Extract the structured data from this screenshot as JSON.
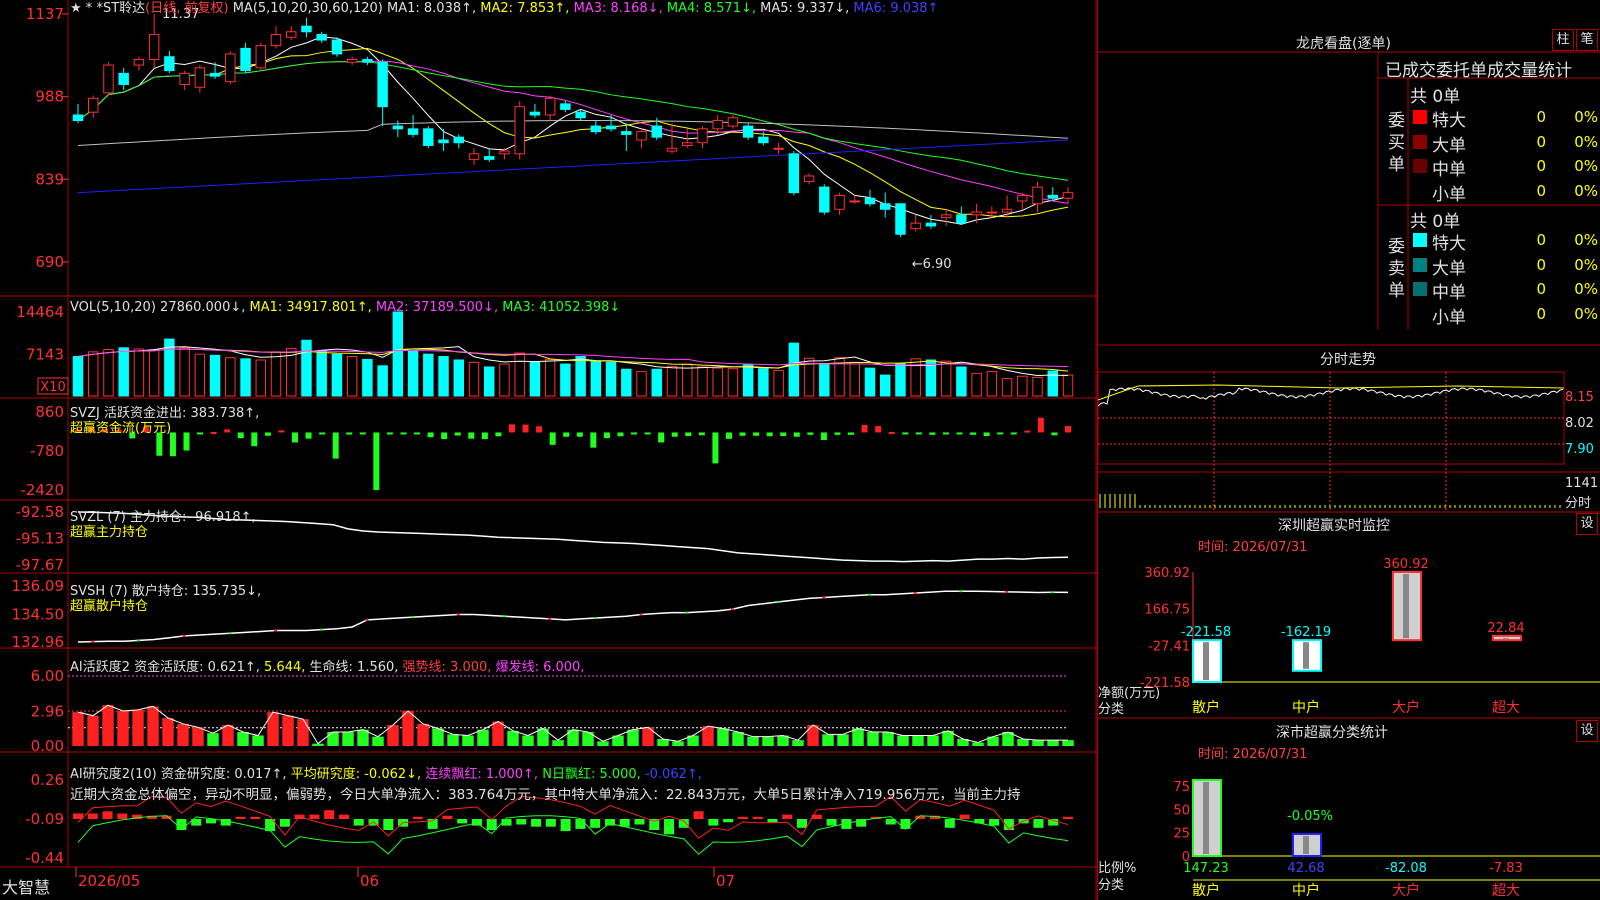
{
  "colors": {
    "up": "#ff3030",
    "down": "#00ffff",
    "vol_up": "#ff3030",
    "vol_down": "#00ffff",
    "ma5": "#ffffff",
    "ma10": "#ffff00",
    "ma20": "#ff40ff",
    "ma30": "#20ff20",
    "ma60": "#c0c0c0",
    "ma120": "#2020ff",
    "frame": "#b00000",
    "pos": "#ff2020",
    "neg": "#20ff20"
  },
  "main": {
    "stars": "★ *",
    "title": "*ST聆达",
    "period": "(日线, 前复权)",
    "ma_label": "MA(5,10,20,30,60,120)",
    "ma1": "MA1: 8.038↑,",
    "ma2": "MA2: 7.853↑,",
    "ma3": "MA3: 8.168↓,",
    "ma4": "MA4: 8.571↓,",
    "ma5": "MA5: 9.337↓,",
    "ma6": "MA6: 9.038↑",
    "y_ticks": [
      "1137",
      "988",
      "839",
      "690"
    ],
    "high_label": "11.37",
    "low_label": "←6.90"
  },
  "vol": {
    "label": "VOL(5,10,20)",
    "value": "27860.000↓,",
    "ma1": "MA1: 34917.801↑,",
    "ma2": "MA2: 37189.500↓,",
    "ma3": "MA3: 41052.398↓",
    "y_ticks": [
      "14464",
      "7143"
    ],
    "unit": "X10"
  },
  "svzj": {
    "label": "SVZJ  活跃资金进出: 383.738↑,",
    "sub": "超赢资金流(万元)",
    "y_ticks": [
      "860",
      "-780",
      "-2420"
    ]
  },
  "svzl": {
    "label": "SVZL (7) 主力持仓: -96.918↑,",
    "sub": "超赢主力持仓",
    "y_ticks": [
      "-92.58",
      "-95.13",
      "-97.67"
    ]
  },
  "svsh": {
    "label": "SVSH (7) 散户持仓: 135.735↓,",
    "sub": "超赢散户持仓",
    "y_ticks": [
      "136.09",
      "134.50",
      "132.96"
    ]
  },
  "ai1": {
    "label": "AI活跃度2 资金活跃度: 0.621↑,",
    "v2": "5.644,",
    "v3": "生命线: 1.560,",
    "v4": "强势线: 3.000,",
    "v5": "爆发线: 6.000,",
    "y_ticks": [
      "6.00",
      "2.96",
      "0.00"
    ]
  },
  "ai2": {
    "label": "AI研究度2(10) 资金研究度: 0.017↑,",
    "v2": "平均研究度: -0.062↓,",
    "v3": "连续飘红: 1.000↑,",
    "v4": "N日飘红: 5.000,",
    "v5": "-0.062↑,",
    "comment": "近期大资金总体偏空，异动不明显，偏弱势，今日大单净流入：383.764万元，其中特大单净流入：22.843万元，大单5日累计净入719.956万元，当前主力持",
    "y_ticks": [
      "0.26",
      "-0.09",
      "-0.44"
    ]
  },
  "xaxis": {
    "labels": [
      "2026/05",
      "06",
      "07"
    ]
  },
  "brand": "大智慧",
  "right": {
    "lhb_title": "龙虎看盘(逐单)",
    "btn1": "柱",
    "btn2": "笔",
    "order_title": "已成交委托单成交量统计",
    "buy": {
      "side": "委买单",
      "total": "共 0单",
      "rows": [
        {
          "name": "特大",
          "color": "#ff0000",
          "n": "0",
          "pct": "0%"
        },
        {
          "name": "大单",
          "color": "#8b0000",
          "n": "0",
          "pct": "0%"
        },
        {
          "name": "中单",
          "color": "#6b0000",
          "n": "0",
          "pct": "0%"
        },
        {
          "name": "小单",
          "color": "#000000",
          "n": "0",
          "pct": "0%"
        }
      ]
    },
    "sell": {
      "side": "委卖单",
      "total": "共 0单",
      "rows": [
        {
          "name": "特大",
          "color": "#00ffff",
          "n": "0",
          "pct": "0%"
        },
        {
          "name": "大单",
          "color": "#008080",
          "n": "0",
          "pct": "0%"
        },
        {
          "name": "中单",
          "color": "#007070",
          "n": "0",
          "pct": "0%"
        },
        {
          "name": "小单",
          "color": "#000000",
          "n": "0",
          "pct": "0%"
        }
      ]
    },
    "intraday_title": "分时走势",
    "intraday_ticks": [
      "8.15",
      "8.02",
      "7.90"
    ],
    "intraday_vol": "1141",
    "intraday_vol_label": "分时",
    "sz_title": "深圳超赢实时监控",
    "sz_time": "时间: 2026/07/31",
    "set": "设",
    "sz_ticks": [
      "360.92",
      "166.75",
      "-27.41",
      "-221.58"
    ],
    "sz_ylabel": "净额(万元)",
    "sz_xlabel": "分类",
    "cat_labels": [
      "散户",
      "中户",
      "大户",
      "超大"
    ],
    "sz_values": [
      "-221.58",
      "-162.19",
      "360.92",
      "22.84"
    ],
    "dist_title": "深市超赢分类统计",
    "dist_time": "时间: 2026/07/31",
    "dist_ticks": [
      "75",
      "50",
      "25",
      "0"
    ],
    "dist_ylabel": "比例%",
    "dist_xlabel": "分类",
    "dist_pct": "-0.05%",
    "dist_values": [
      "147.23",
      "42.68",
      "-82.08",
      "-7.83"
    ]
  },
  "chart_data": [
    {
      "type": "candlestick",
      "title": "*ST聆达 (日线, 前复权)",
      "ylim": [
        6.9,
        11.37
      ],
      "y_ticks": [
        11.37,
        9.88,
        8.39,
        6.9
      ],
      "ohlc": [
        [
          9.55,
          9.75,
          9.4,
          9.45
        ],
        [
          9.6,
          9.9,
          9.5,
          9.85
        ],
        [
          9.95,
          10.5,
          9.9,
          10.45
        ],
        [
          10.3,
          10.4,
          10.0,
          10.1
        ],
        [
          10.45,
          10.6,
          10.35,
          10.55
        ],
        [
          10.55,
          11.37,
          10.4,
          11.0
        ],
        [
          10.6,
          10.7,
          10.3,
          10.35
        ],
        [
          10.1,
          10.35,
          10.0,
          10.3
        ],
        [
          10.05,
          10.45,
          9.95,
          10.4
        ],
        [
          10.3,
          10.5,
          10.2,
          10.25
        ],
        [
          10.15,
          10.7,
          10.1,
          10.65
        ],
        [
          10.75,
          10.85,
          10.3,
          10.35
        ],
        [
          10.4,
          10.85,
          10.35,
          10.8
        ],
        [
          10.8,
          11.15,
          10.75,
          11.0
        ],
        [
          10.95,
          11.15,
          10.9,
          11.05
        ],
        [
          11.15,
          11.3,
          10.95,
          11.05
        ],
        [
          11.0,
          11.05,
          10.85,
          10.9
        ],
        [
          10.9,
          10.95,
          10.6,
          10.65
        ],
        [
          10.5,
          10.6,
          10.45,
          10.55
        ],
        [
          10.55,
          10.6,
          10.45,
          10.5
        ],
        [
          10.5,
          10.55,
          9.35,
          9.7
        ],
        [
          9.35,
          9.45,
          9.15,
          9.3
        ],
        [
          9.3,
          9.55,
          9.15,
          9.2
        ],
        [
          9.3,
          9.35,
          8.95,
          9.0
        ],
        [
          9.1,
          9.3,
          8.9,
          9.05
        ],
        [
          9.15,
          9.2,
          8.95,
          9.05
        ],
        [
          8.75,
          8.95,
          8.65,
          8.85
        ],
        [
          8.8,
          8.95,
          8.7,
          8.75
        ],
        [
          8.85,
          8.95,
          8.75,
          8.9
        ],
        [
          8.85,
          9.8,
          8.75,
          9.7
        ],
        [
          9.6,
          9.75,
          9.5,
          9.55
        ],
        [
          9.55,
          9.9,
          9.45,
          9.85
        ],
        [
          9.75,
          9.8,
          9.6,
          9.65
        ],
        [
          9.6,
          9.65,
          9.45,
          9.5
        ],
        [
          9.35,
          9.45,
          9.2,
          9.25
        ],
        [
          9.35,
          9.55,
          9.25,
          9.3
        ],
        [
          9.25,
          9.4,
          8.9,
          9.2
        ],
        [
          9.1,
          9.3,
          8.95,
          9.25
        ],
        [
          9.35,
          9.5,
          9.1,
          9.15
        ],
        [
          8.9,
          9.4,
          8.85,
          8.95
        ],
        [
          9.0,
          9.3,
          8.95,
          9.05
        ],
        [
          9.05,
          9.35,
          8.95,
          9.3
        ],
        [
          9.3,
          9.55,
          9.2,
          9.45
        ],
        [
          9.35,
          9.55,
          9.3,
          9.5
        ],
        [
          9.35,
          9.4,
          9.1,
          9.15
        ],
        [
          9.15,
          9.25,
          9.0,
          9.05
        ],
        [
          8.95,
          9.05,
          8.85,
          8.95
        ],
        [
          8.85,
          8.9,
          8.1,
          8.15
        ],
        [
          8.35,
          8.5,
          8.3,
          8.45
        ],
        [
          8.25,
          8.3,
          7.75,
          7.8
        ],
        [
          7.85,
          8.15,
          7.75,
          8.1
        ],
        [
          8.0,
          8.1,
          7.95,
          8.0
        ],
        [
          8.05,
          8.2,
          7.9,
          7.95
        ],
        [
          7.95,
          8.15,
          7.7,
          7.85
        ],
        [
          7.95,
          7.95,
          7.35,
          7.4
        ],
        [
          7.5,
          7.75,
          7.45,
          7.6
        ],
        [
          7.6,
          7.75,
          7.5,
          7.55
        ],
        [
          7.7,
          7.85,
          7.55,
          7.75
        ],
        [
          7.75,
          7.9,
          7.6,
          7.6
        ],
        [
          7.75,
          7.95,
          7.6,
          7.8
        ],
        [
          7.8,
          7.9,
          7.7,
          7.8
        ],
        [
          7.8,
          8.1,
          7.7,
          7.85
        ],
        [
          8.0,
          8.15,
          7.85,
          8.1
        ],
        [
          7.95,
          8.35,
          7.8,
          8.25
        ],
        [
          8.1,
          8.25,
          8.0,
          8.05
        ],
        [
          8.05,
          8.25,
          7.95,
          8.15
        ]
      ],
      "ma_last": {
        "MA1": 8.038,
        "MA2": 7.853,
        "MA3": 8.168,
        "MA4": 8.571,
        "MA5": 9.337,
        "MA6": 9.038
      }
    },
    {
      "type": "bar",
      "title": "VOL(5,10,20)",
      "unit": "X10",
      "ylim": [
        0,
        14464
      ],
      "values": [
        6800,
        7600,
        8000,
        8300,
        8100,
        7900,
        9800,
        8300,
        7200,
        7000,
        6600,
        6400,
        6200,
        7600,
        8200,
        9600,
        7800,
        7200,
        6800,
        6300,
        5200,
        14464,
        7800,
        7200,
        6800,
        6200,
        5800,
        5000,
        5500,
        7400,
        5900,
        6300,
        5500,
        6800,
        6000,
        5800,
        4600,
        4200,
        4600,
        5100,
        5500,
        5000,
        4800,
        4700,
        5400,
        4700,
        4400,
        9100,
        6500,
        5600,
        6600,
        5800,
        4800,
        3600,
        5600,
        6400,
        6200,
        6000,
        5000,
        3900,
        4200,
        3000,
        3400,
        3200,
        4300,
        3600
      ],
      "ma1": 34917.801,
      "ma2": 37189.5,
      "ma3": 41052.398,
      "last": 27860.0
    },
    {
      "type": "bar",
      "title": "SVZJ 活跃资金进出",
      "ylabel": "超赢资金流(万元)",
      "ylim": [
        -2420,
        860
      ],
      "values": [
        120,
        200,
        150,
        110,
        -250,
        240,
        -980,
        -1000,
        -760,
        -80,
        20,
        130,
        -240,
        -580,
        -140,
        90,
        -420,
        -260,
        -80,
        -1100,
        -90,
        -40,
        -2420,
        -60,
        -80,
        -70,
        -200,
        -280,
        -130,
        -260,
        -280,
        -160,
        340,
        330,
        260,
        -520,
        -180,
        -180,
        -640,
        -240,
        -160,
        -40,
        -60,
        -420,
        -180,
        -150,
        -120,
        -1300,
        -270,
        -140,
        -140,
        -160,
        -150,
        -180,
        -100,
        -320,
        -100,
        -100,
        320,
        270,
        20,
        -60,
        -60,
        -100,
        -70,
        -60,
        -100,
        -150,
        -80,
        -60,
        80,
        620,
        -120,
        270
      ],
      "last": 383.738
    },
    {
      "type": "line",
      "title": "SVZL (7) 主力持仓",
      "ylabel": "超赢主力持仓",
      "ylim": [
        -97.67,
        -92.58
      ],
      "last": -96.918,
      "values": [
        -92.58,
        -92.6,
        -92.65,
        -92.7,
        -92.8,
        -92.9,
        -93.0,
        -93.05,
        -93.1,
        -93.2,
        -93.3,
        -93.35,
        -93.4,
        -93.45,
        -93.5,
        -93.6,
        -93.7,
        -93.8,
        -94.2,
        -94.4,
        -94.5,
        -94.55,
        -94.6,
        -94.65,
        -94.7,
        -94.75,
        -94.8,
        -94.9,
        -95.0,
        -95.05,
        -95.1,
        -95.15,
        -95.2,
        -95.3,
        -95.4,
        -95.5,
        -95.55,
        -95.6,
        -95.7,
        -95.8,
        -95.9,
        -96.0,
        -96.1,
        -96.3,
        -96.5,
        -96.6,
        -96.7,
        -96.8,
        -96.9,
        -97.0,
        -97.1,
        -97.2,
        -97.25,
        -97.3,
        -97.3,
        -97.35,
        -97.3,
        -97.25,
        -97.3,
        -97.2,
        -97.1,
        -97.1,
        -97.05,
        -97.1,
        -97.0,
        -96.95,
        -96.92
      ]
    },
    {
      "type": "line",
      "title": "SVSH (7) 散户持仓",
      "ylabel": "超赢散户持仓",
      "ylim": [
        132.96,
        136.09
      ],
      "last": 135.735,
      "values": [
        132.96,
        132.98,
        133.0,
        133.0,
        133.05,
        133.1,
        133.2,
        133.3,
        133.35,
        133.4,
        133.45,
        133.5,
        133.55,
        133.6,
        133.6,
        133.6,
        133.65,
        133.7,
        133.8,
        134.2,
        134.25,
        134.3,
        134.35,
        134.4,
        134.45,
        134.5,
        134.5,
        134.45,
        134.4,
        134.35,
        134.3,
        134.25,
        134.2,
        134.25,
        134.3,
        134.35,
        134.4,
        134.5,
        134.55,
        134.6,
        134.6,
        134.65,
        134.7,
        134.8,
        135.0,
        135.1,
        135.2,
        135.3,
        135.4,
        135.45,
        135.5,
        135.55,
        135.6,
        135.6,
        135.65,
        135.7,
        135.75,
        135.8,
        135.8,
        135.8,
        135.78,
        135.76,
        135.75,
        135.73,
        135.74,
        135.735
      ]
    },
    {
      "type": "bar",
      "title": "AI活跃度2 资金活跃度",
      "ylim": [
        0,
        6.0
      ],
      "last": 0.621,
      "values": [
        2.9,
        2.6,
        3.5,
        3.0,
        3.1,
        3.4,
        2.4,
        1.9,
        1.6,
        1.1,
        1.8,
        1.2,
        0.9,
        2.9,
        2.6,
        2.3,
        0.2,
        1.2,
        1.2,
        1.4,
        0.8,
        1.8,
        3.0,
        1.9,
        1.5,
        1.0,
        0.9,
        1.4,
        2.1,
        1.3,
        0.9,
        1.5,
        0.5,
        1.4,
        1.2,
        0.4,
        0.9,
        1.4,
        1.6,
        0.6,
        0.4,
        0.9,
        1.7,
        1.5,
        1.2,
        0.8,
        0.8,
        0.9,
        0.5,
        1.8,
        1.0,
        1.0,
        1.5,
        1.2,
        1.2,
        0.9,
        0.9,
        0.9,
        1.3,
        0.6,
        0.3,
        0.8,
        1.2,
        0.6,
        0.5,
        0.5,
        0.5
      ],
      "levels": {
        "生命线": 1.56,
        "强势线": 3.0,
        "爆发线": 6.0
      }
    },
    {
      "type": "bar",
      "title": "AI研究度2(10) 资金研究度",
      "ylim": [
        -0.44,
        0.26
      ],
      "last": 0.017,
      "values": [
        0.05,
        0.05,
        0.07,
        0.05,
        0.04,
        0.03,
        0.03,
        -0.1,
        -0.06,
        -0.04,
        -0.06,
        0.02,
        0.02,
        -0.11,
        -0.07,
        0.04,
        0.04,
        0.08,
        0.04,
        -0.06,
        -0.06,
        -0.1,
        -0.07,
        0.02,
        -0.09,
        0.03,
        -0.04,
        -0.06,
        -0.1,
        -0.06,
        -0.05,
        -0.07,
        -0.07,
        -0.11,
        -0.09,
        -0.08,
        -0.06,
        -0.07,
        -0.05,
        -0.1,
        -0.14,
        -0.08,
        0.07,
        -0.06,
        -0.03,
        0.02,
        0.02,
        -0.03,
        0.04,
        -0.08,
        0.04,
        -0.06,
        -0.09,
        -0.07,
        0.02,
        -0.05,
        -0.09,
        0.03,
        0.03,
        -0.08,
        0.04,
        -0.04,
        -0.06,
        -0.1,
        -0.04,
        -0.08,
        -0.06,
        0.02
      ],
      "avg": -0.062
    },
    {
      "type": "bar",
      "title": "深圳超赢实时监控",
      "categories": [
        "散户",
        "中户",
        "大户",
        "超大"
      ],
      "values": [
        -221.58,
        -162.19,
        360.92,
        22.84
      ],
      "ylim": [
        -221.58,
        360.92
      ],
      "ylabel": "净额(万元)"
    },
    {
      "type": "bar",
      "title": "深市超赢分类统计",
      "categories": [
        "散户",
        "中户",
        "大户",
        "超大"
      ],
      "values": [
        147.23,
        42.68,
        -82.08,
        -7.83
      ],
      "ylabel": "比例%",
      "y_ticks": [
        75,
        50,
        25,
        0
      ]
    }
  ]
}
